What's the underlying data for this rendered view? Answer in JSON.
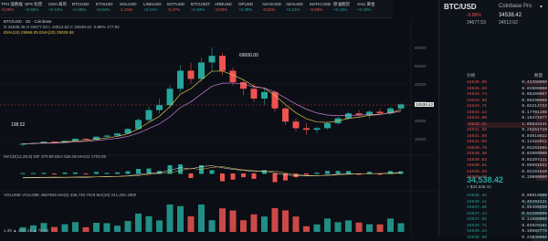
{
  "ticker": [
    {
      "sym": "TPH 涨跌幅",
      "pct": "-0.25%"
    },
    {
      "sym": "SPX 标普",
      "pct": "+0.55%"
    },
    {
      "sym": "CNH 离岸",
      "pct": "+0.12%"
    },
    {
      "sym": "BTCUSD",
      "pct": "+1.85%"
    },
    {
      "sym": "ETHUSD",
      "pct": "+0.64%"
    },
    {
      "sym": "SOLUSD",
      "pct": "-1.21%"
    },
    {
      "sym": "LINKUSD",
      "pct": "+2.01%"
    },
    {
      "sym": "DOTUSD",
      "pct": "-0.47%"
    },
    {
      "sym": "BTCUSDT",
      "pct": "+1.84%"
    },
    {
      "sym": "ARBUSD",
      "pct": "-0.93%"
    },
    {
      "sym": "OPUSD",
      "pct": "+0.38%"
    },
    {
      "sym": "AVAXUSD",
      "pct": "-0.52%"
    },
    {
      "sym": "ADAUSD",
      "pct": "+0.21%"
    },
    {
      "sym": "MATICUSD",
      "pct": "-0.66%"
    },
    {
      "sym": "原油期货",
      "pct": "+0.44%"
    },
    {
      "sym": "XAU 黄金",
      "pct": "+0.19%"
    }
  ],
  "info": {
    "line1": "BTC/USD · 1D · Coinbase",
    "line2": "O 34538.45  H 34677.53  L 34512.62  C 34538.42  -0.86%  177.82",
    "ema": "EMA(15) 29966.05   EMA(20) 29029.98",
    "peak_label": "69000.00",
    "low_label": "198.52",
    "price_tag": "34538.42",
    "macd": "MACD(12,26,9)  DIF 370.69  DEA 526.06  MACD 1703.09",
    "vol": "VOLUME  VOLUME 4567845  MA(5) 236,745.7019  MA(10) 241,292.1800",
    "bottom": "1.39 ▲ 4.51.21 ▲ 79.08"
  },
  "ob": {
    "title": "BTC/USD",
    "exchange": "Coinbase Pro",
    "price": "34538.42",
    "change": "-0.86%",
    "hi": "34677.53",
    "lo": "34512.62",
    "last": "34,538.42",
    "sub": "≈ $34,538.42",
    "header": [
      "价格",
      "数量"
    ],
    "asks": [
      {
        "p": "34546.80",
        "q": "0.42350000"
      },
      {
        "p": "34545.63",
        "q": "0.02000000"
      },
      {
        "p": "34544.74",
        "q": "0.05499067"
      },
      {
        "p": "34543.96",
        "q": "0.06290000"
      },
      {
        "p": "34543.71",
        "q": "0.02214722"
      },
      {
        "p": "34543.12",
        "q": "0.17781100"
      },
      {
        "p": "34542.80",
        "q": "0.10471077"
      },
      {
        "p": "34542.31",
        "q": "1.95833341"
      },
      {
        "p": "34541.92",
        "q": "0.26251729"
      },
      {
        "p": "34541.55",
        "q": "0.03018022"
      },
      {
        "p": "34541.08",
        "q": "0.11324011"
      },
      {
        "p": "34540.76",
        "q": "0.04282986"
      },
      {
        "p": "34540.40",
        "q": "0.02000000"
      },
      {
        "p": "34540.03",
        "q": "0.02297111"
      },
      {
        "p": "34539.61",
        "q": "0.08991922"
      },
      {
        "p": "34539.20",
        "q": "0.02101920"
      },
      {
        "p": "34538.76",
        "q": "0.10000000"
      }
    ],
    "bids": [
      {
        "p": "34538.42",
        "q": "0.00510000"
      },
      {
        "p": "34538.11",
        "q": "0.45494221"
      },
      {
        "p": "34537.80",
        "q": "0.05490850"
      },
      {
        "p": "34537.44",
        "q": "0.52100000"
      },
      {
        "p": "34537.02",
        "q": "0.11860000"
      },
      {
        "p": "34536.71",
        "q": "0.02020181"
      },
      {
        "p": "34536.33",
        "q": "0.10584776"
      },
      {
        "p": "34535.90",
        "q": "0.22040000"
      }
    ],
    "chevron": "▾"
  },
  "chart_data": {
    "type": "candlestick",
    "candles": [
      [
        10,
        11,
        9,
        10.5
      ],
      [
        10.5,
        11.5,
        10,
        11
      ],
      [
        11,
        12,
        10.5,
        11.8
      ],
      [
        11.8,
        12,
        11,
        11.2
      ],
      [
        11.2,
        12.5,
        11,
        12.3
      ],
      [
        12.3,
        13.8,
        12,
        13.5
      ],
      [
        13.5,
        14,
        12.6,
        13
      ],
      [
        13,
        15,
        12.8,
        14.8
      ],
      [
        14.8,
        16,
        14.2,
        15.5
      ],
      [
        15.5,
        17,
        15,
        16.8
      ],
      [
        16.8,
        20,
        16.5,
        19.5
      ],
      [
        19.5,
        26,
        19,
        25
      ],
      [
        25,
        33,
        24,
        31
      ],
      [
        31,
        38,
        29,
        34
      ],
      [
        34,
        46,
        32,
        44
      ],
      [
        44,
        58,
        42,
        55
      ],
      [
        55,
        60,
        47,
        50
      ],
      [
        50,
        63,
        48,
        60
      ],
      [
        60,
        69,
        55,
        64
      ],
      [
        64,
        66,
        52,
        55
      ],
      [
        55,
        57,
        46,
        48
      ],
      [
        48,
        50,
        40,
        44
      ],
      [
        44,
        47,
        36,
        38
      ],
      [
        38,
        44,
        34,
        42
      ],
      [
        42,
        43,
        30,
        32
      ],
      [
        32,
        33,
        22,
        24
      ],
      [
        24,
        26,
        18,
        20
      ],
      [
        20,
        23,
        16,
        19
      ],
      [
        19,
        21,
        17,
        20
      ],
      [
        20,
        24,
        19,
        23
      ],
      [
        23,
        27,
        22,
        26
      ],
      [
        26,
        30,
        25,
        29
      ],
      [
        29,
        31,
        27,
        28
      ],
      [
        28,
        31,
        26,
        30
      ],
      [
        30,
        32,
        28,
        29
      ],
      [
        29,
        33,
        28,
        32
      ],
      [
        32,
        35,
        31,
        34.5
      ]
    ],
    "peak": 69000,
    "low": 198.52
  }
}
